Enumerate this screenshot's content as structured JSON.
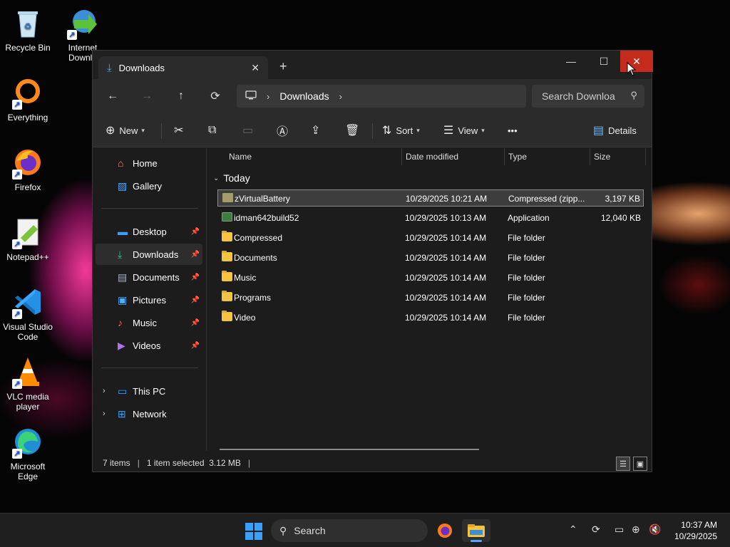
{
  "desktop": {
    "icons": [
      {
        "label": "Recycle Bin",
        "icon": "recycle-bin-icon"
      },
      {
        "label": "Internet Downlo",
        "icon": "internet-download-manager-icon"
      },
      {
        "label": "Everything",
        "icon": "everything-search-icon"
      },
      {
        "label": "Firefox",
        "icon": "firefox-icon"
      },
      {
        "label": "Notepad++",
        "icon": "notepad-plus-plus-icon"
      },
      {
        "label": "Visual Studio Code",
        "icon": "vscode-icon"
      },
      {
        "label": "VLC media player",
        "icon": "vlc-icon"
      },
      {
        "label": "Microsoft Edge",
        "icon": "edge-icon"
      }
    ]
  },
  "window": {
    "tab_title": "Downloads",
    "new_tab": "+",
    "controls": {
      "minimize": "—",
      "maximize": "☐",
      "close": "✕"
    }
  },
  "nav": {
    "back": "←",
    "forward": "→",
    "up": "↑",
    "refresh": "⟳",
    "breadcrumb": "Downloads",
    "search_placeholder": "Search Downloa"
  },
  "commandbar": {
    "new_label": "New",
    "sort_label": "Sort",
    "view_label": "View",
    "more": "•••",
    "details_label": "Details"
  },
  "sidebar": {
    "items": [
      {
        "label": "Home",
        "icon": "home-icon"
      },
      {
        "label": "Gallery",
        "icon": "gallery-icon"
      },
      {
        "label": "Desktop",
        "icon": "desktop-icon",
        "pinned": true
      },
      {
        "label": "Downloads",
        "icon": "downloads-icon",
        "pinned": true,
        "selected": true
      },
      {
        "label": "Documents",
        "icon": "documents-icon",
        "pinned": true
      },
      {
        "label": "Pictures",
        "icon": "pictures-icon",
        "pinned": true
      },
      {
        "label": "Music",
        "icon": "music-icon",
        "pinned": true
      },
      {
        "label": "Videos",
        "icon": "videos-icon",
        "pinned": true
      },
      {
        "label": "This PC",
        "icon": "this-pc-icon",
        "expandable": true
      },
      {
        "label": "Network",
        "icon": "network-icon",
        "expandable": true
      }
    ]
  },
  "filelist": {
    "columns": [
      "Name",
      "Date modified",
      "Type",
      "Size"
    ],
    "group": "Today",
    "rows": [
      {
        "name": "zVirtualBattery",
        "date": "10/29/2025 10:21 AM",
        "type": "Compressed (zipp...",
        "size": "3,197 KB",
        "icon": "zip-icon",
        "selected": true
      },
      {
        "name": "idman642build52",
        "date": "10/29/2025 10:13 AM",
        "type": "Application",
        "size": "12,040 KB",
        "icon": "application-icon"
      },
      {
        "name": "Compressed",
        "date": "10/29/2025 10:14 AM",
        "type": "File folder",
        "size": "",
        "icon": "folder-icon"
      },
      {
        "name": "Documents",
        "date": "10/29/2025 10:14 AM",
        "type": "File folder",
        "size": "",
        "icon": "folder-icon"
      },
      {
        "name": "Music",
        "date": "10/29/2025 10:14 AM",
        "type": "File folder",
        "size": "",
        "icon": "folder-icon"
      },
      {
        "name": "Programs",
        "date": "10/29/2025 10:14 AM",
        "type": "File folder",
        "size": "",
        "icon": "folder-icon"
      },
      {
        "name": "Video",
        "date": "10/29/2025 10:14 AM",
        "type": "File folder",
        "size": "",
        "icon": "folder-icon"
      }
    ]
  },
  "status": {
    "items_count": "7 items",
    "selection": "1 item selected  3.12 MB",
    "separator": "|"
  },
  "taskbar": {
    "search_label": "Search",
    "time": "10:37 AM",
    "date": "10/29/2025"
  },
  "colors": {
    "accent": "#3aa0ff",
    "close_red": "#c42b1c",
    "folder": "#f5c542"
  }
}
